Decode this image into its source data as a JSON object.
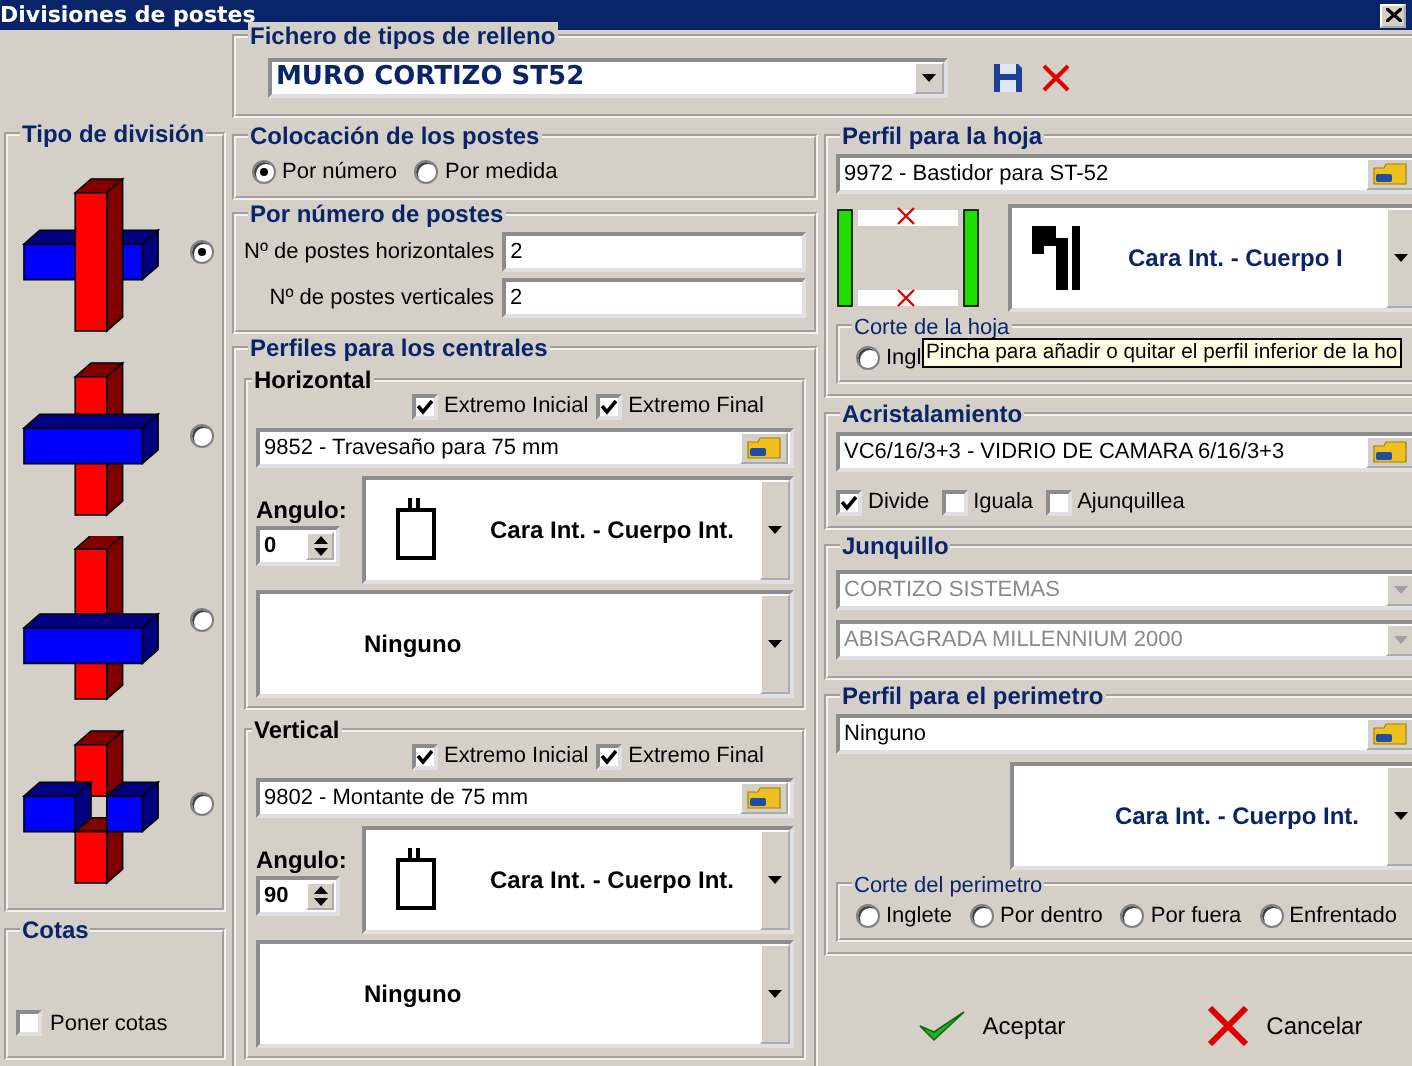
{
  "window": {
    "title": "Divisiones de postes"
  },
  "fill_file": {
    "title": "Fichero de tipos de relleno",
    "value": "MURO CORTIZO ST52"
  },
  "division_type": {
    "title": "Tipo de división",
    "options": [
      {
        "kind": "vertical-over",
        "selected": true
      },
      {
        "kind": "horizontal-over",
        "selected": false
      },
      {
        "kind": "horizontal-over-low",
        "selected": false
      },
      {
        "kind": "separate",
        "selected": false
      }
    ]
  },
  "dimensions": {
    "title": "Cotas",
    "label": "Poner cotas",
    "checked": false
  },
  "placement": {
    "title": "Colocación de los postes",
    "options": [
      {
        "label": "Por número",
        "selected": true
      },
      {
        "label": "Por medida",
        "selected": false
      }
    ]
  },
  "by_number": {
    "title": "Por número de postes",
    "fields": [
      {
        "label": "Nº de postes horizontales",
        "value": "2"
      },
      {
        "label": "Nº de postes verticales",
        "value": "2"
      }
    ]
  },
  "central_profiles": {
    "title": "Perfiles para los centrales",
    "sections": [
      {
        "title": "Horizontal",
        "checks": [
          {
            "label": "Extremo Inicial",
            "checked": true
          },
          {
            "label": "Extremo Final",
            "checked": true
          }
        ],
        "profile": "9852 - Travesaño para 75 mm",
        "angle_label": "Angulo:",
        "angle": "0",
        "face": "Cara Int. - Cuerpo Int.",
        "second": "Ninguno"
      },
      {
        "title": "Vertical",
        "checks": [
          {
            "label": "Extremo Inicial",
            "checked": true
          },
          {
            "label": "Extremo Final",
            "checked": true
          }
        ],
        "profile": "9802 - Montante de 75 mm",
        "angle_label": "Angulo:",
        "angle": "90",
        "face": "Cara Int. - Cuerpo Int.",
        "second": "Ninguno"
      }
    ]
  },
  "leaf_profile": {
    "title": "Perfil para la hoja",
    "profile": "9972 - Bastidor para ST-52",
    "face": "Cara Int. - Cuerpo I",
    "cut": {
      "title": "Corte de la hoja",
      "options": [
        {
          "label": "Ingl",
          "selected": false
        }
      ]
    },
    "tooltip": "Pincha para añadir o quitar el perfil inferior de la ho"
  },
  "glazing": {
    "title": "Acristalamiento",
    "profile": "VC6/16/3+3 - VIDRIO DE CAMARA 6/16/3+3",
    "checks": [
      {
        "label": "Divide",
        "checked": true
      },
      {
        "label": "Iguala",
        "checked": false
      },
      {
        "label": "Ajunquillea",
        "checked": false
      }
    ]
  },
  "bead": {
    "title": "Junquillo",
    "disabled": true,
    "selects": [
      "CORTIZO SISTEMAS",
      "ABISAGRADA MILLENNIUM 2000"
    ]
  },
  "perimeter": {
    "title": "Perfil para el perimetro",
    "profile": "Ninguno",
    "face": "Cara Int. - Cuerpo Int.",
    "cut": {
      "title": "Corte del perimetro",
      "options": [
        {
          "label": "Inglete",
          "selected": false
        },
        {
          "label": "Por dentro",
          "selected": false
        },
        {
          "label": "Por fuera",
          "selected": false
        },
        {
          "label": "Enfrentado",
          "selected": false
        }
      ]
    }
  },
  "buttons": [
    {
      "kind": "accept",
      "label": "Aceptar"
    },
    {
      "kind": "cancel",
      "label": "Cancelar"
    }
  ]
}
